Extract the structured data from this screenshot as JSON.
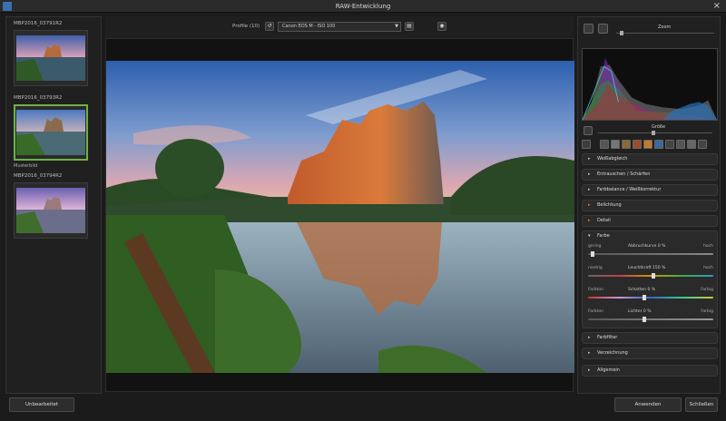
{
  "window": {
    "title": "RAW-Entwicklung",
    "close": "×"
  },
  "filmstrip": [
    {
      "label": "MBP2016_03791R2",
      "caption": "",
      "selected": false
    },
    {
      "label": "MBP2016_03793R2",
      "caption": "Musterbild",
      "selected": true
    },
    {
      "label": "MBP2016_03794R2",
      "caption": "",
      "selected": false
    }
  ],
  "toolbar": {
    "profile_label": "Profile (10)",
    "profile_value": "Canon EOS M - ISO 100",
    "reset_icon": "reset-icon",
    "save_icon": "save-icon",
    "camera_icon": "camera-icon"
  },
  "right": {
    "zoom_label": "Zoom",
    "zoom_level": 0.04,
    "size_label": "Größe",
    "size_level": 0.48
  },
  "sections": {
    "collapsed_top": [
      {
        "label": "Weißabgleich",
        "accent": false
      },
      {
        "label": "Entrauschen / Schärfen",
        "accent": false
      },
      {
        "label": "Farbbalance / Weißkorrektur",
        "accent": false
      },
      {
        "label": "Belichtung",
        "accent": true
      },
      {
        "label": "Detail",
        "accent": true
      }
    ],
    "open": {
      "label": "Farbe",
      "sliders": [
        {
          "left": "gering",
          "mid": "Abbruchkurve 0 %",
          "right": "hoch",
          "value": 0.02
        },
        {
          "left": "niedrig",
          "mid": "Leuchtkraft 150 %",
          "right": "hoch",
          "value": 0.52
        },
        {
          "left": "Farbton",
          "mid": "Schatten 0 %",
          "right": "Farbig",
          "value": 0.45
        },
        {
          "left": "Farbton",
          "mid": "Lichter 0 %",
          "right": "Farbig",
          "value": 0.45
        }
      ]
    },
    "collapsed_bottom": [
      {
        "label": "Farbfilter"
      },
      {
        "label": "Verzeichnung"
      },
      {
        "label": "Allgemein"
      }
    ]
  },
  "buttons": {
    "unbearbeitet": "Unbearbeitet",
    "anwenden": "Anwenden",
    "schliessen": "Schließen"
  }
}
